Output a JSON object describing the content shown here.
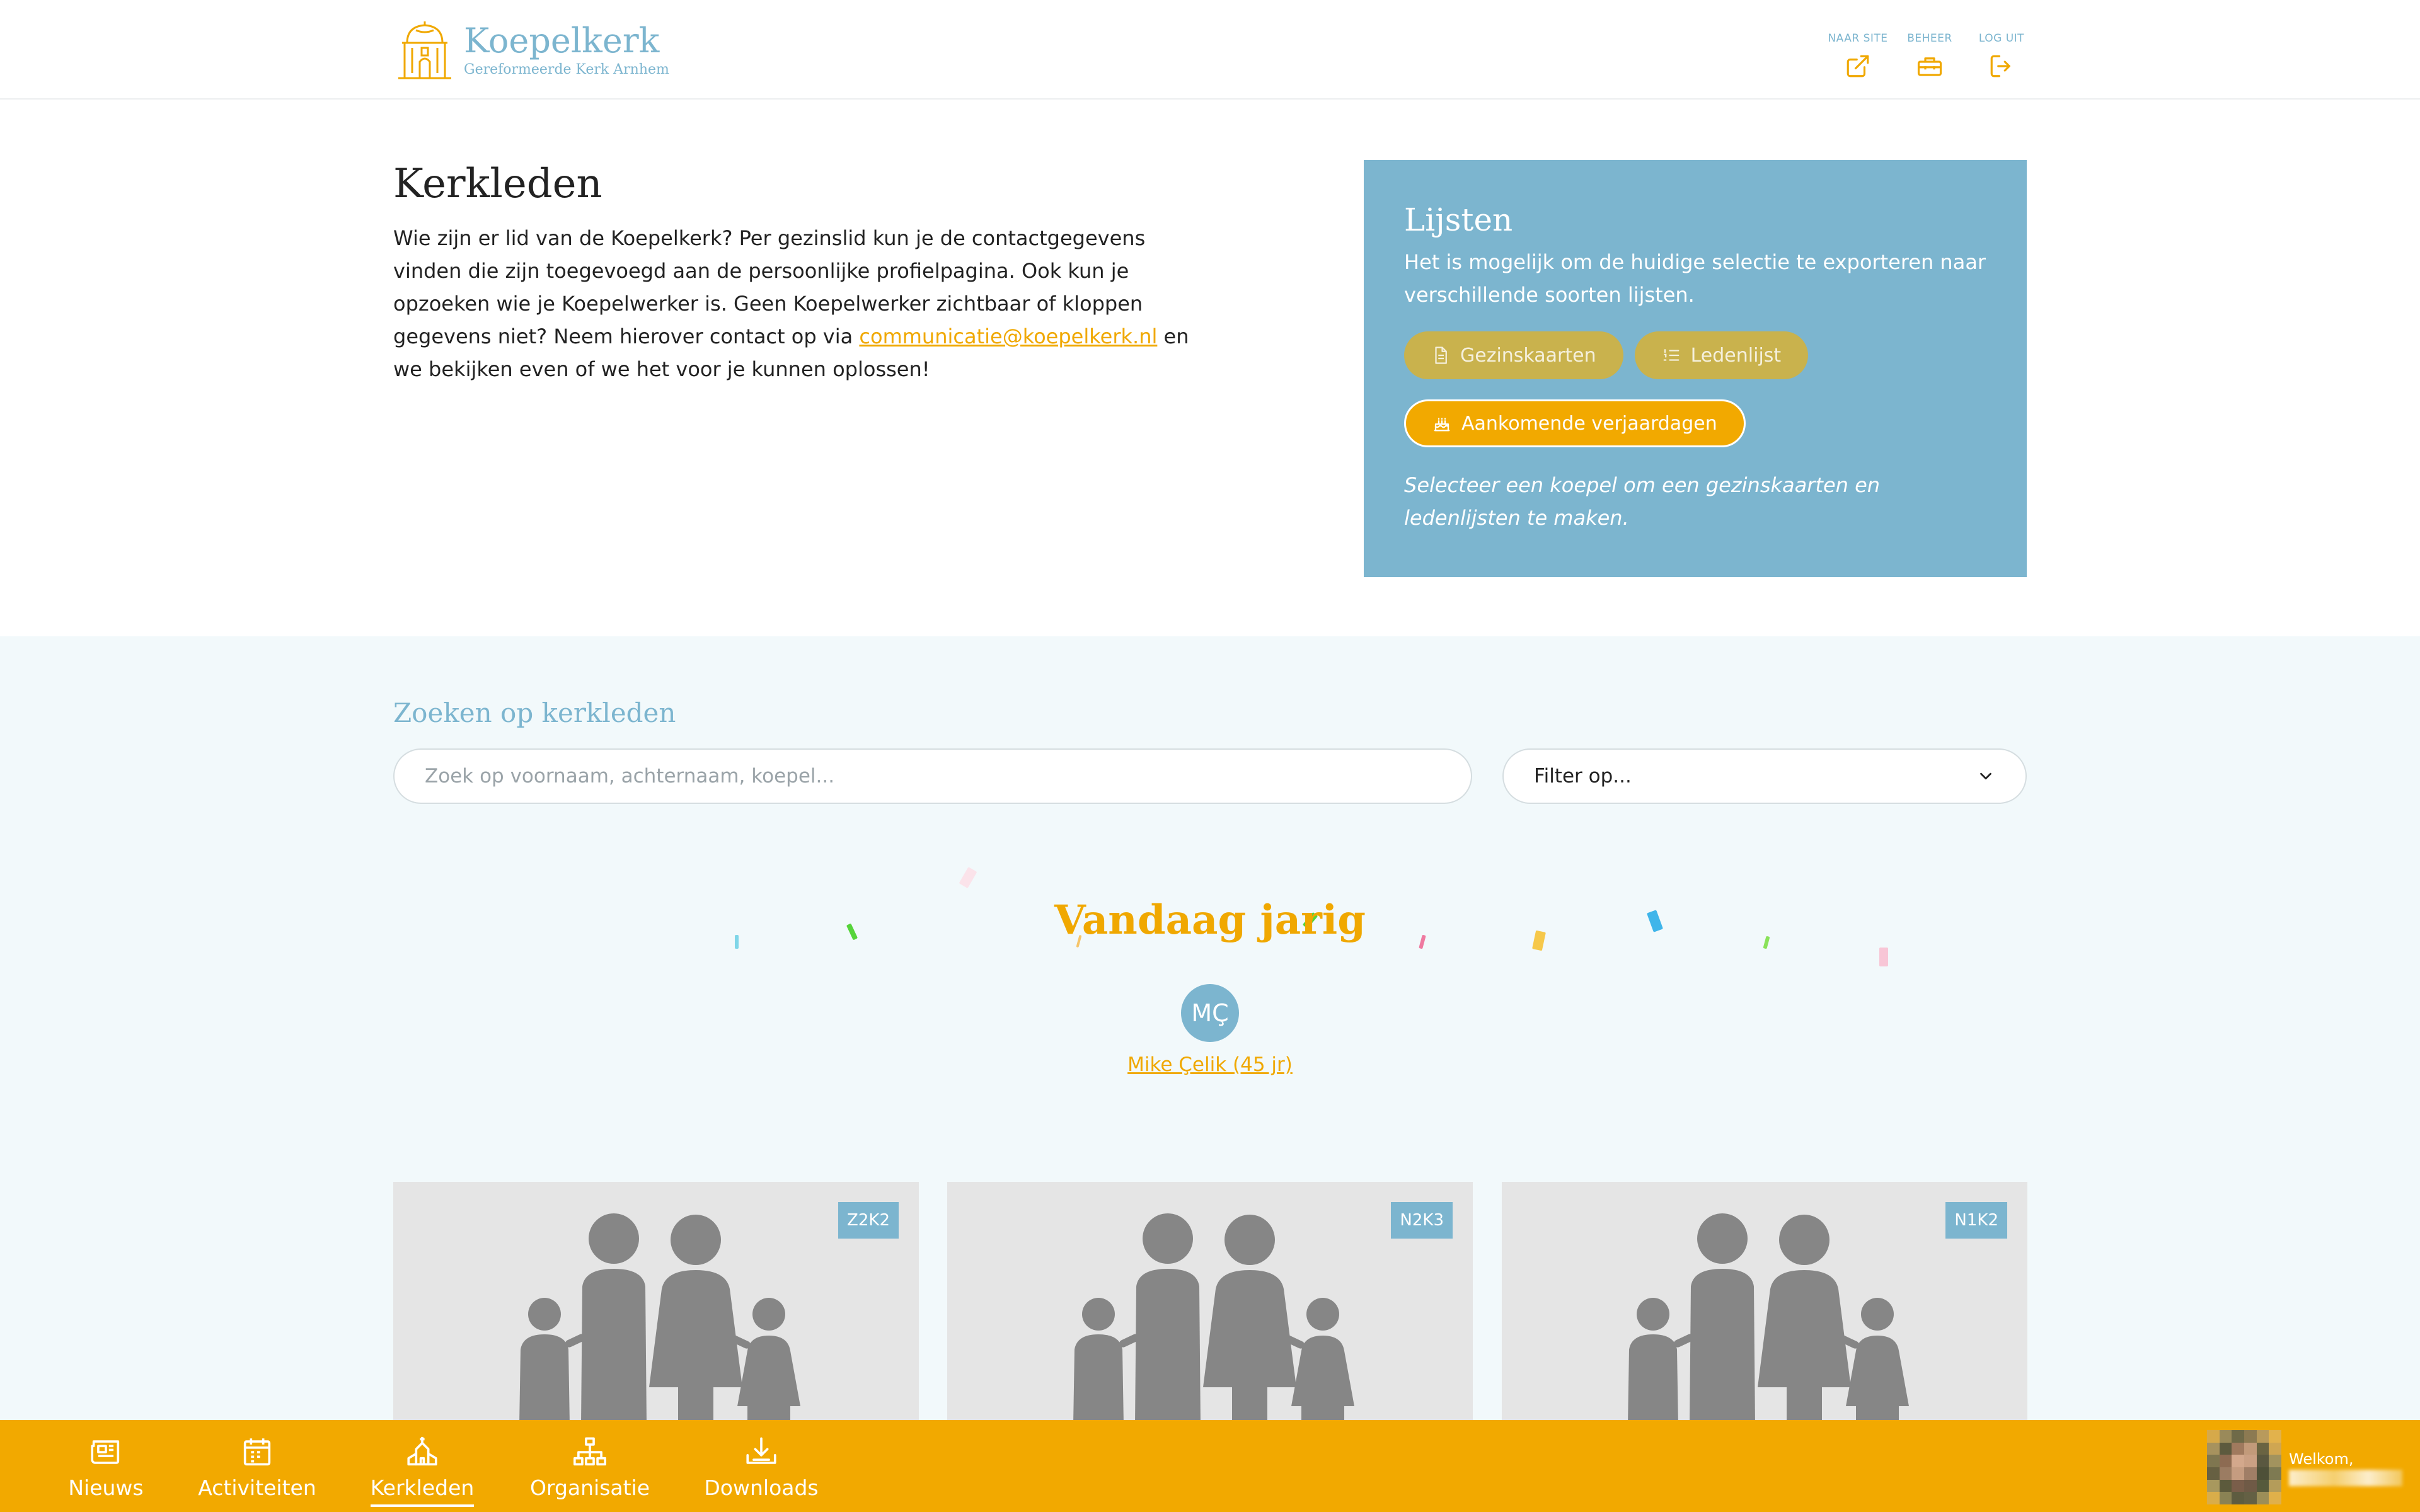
{
  "header": {
    "logo_title": "Koepelkerk",
    "logo_subtitle": "Gereformeerde Kerk Arnhem",
    "actions": [
      {
        "label": "NAAR SITE",
        "icon": "external-link-icon"
      },
      {
        "label": "BEHEER",
        "icon": "toolbox-icon"
      },
      {
        "label": "LOG UIT",
        "icon": "logout-icon"
      }
    ]
  },
  "intro": {
    "title": "Kerkleden",
    "text_before": "Wie zijn er lid van de Koepelkerk? Per gezinslid kun je de contactgegevens vinden die zijn toegevoegd aan de persoonlijke profielpagina. Ook kun je opzoeken wie je Koepelwerker is. Geen Koepelwerker zichtbaar of kloppen gegevens niet? Neem hierover contact op via ",
    "link": "communicatie@koepelkerk.nl",
    "text_after": " en we bekijken even of we het voor je kunnen oplossen!"
  },
  "lists": {
    "title": "Lijsten",
    "text": "Het is mogelijk om de huidige selectie te exporteren naar verschillende soorten lijsten.",
    "gezinskaarten_label": "Gezinskaarten",
    "ledenlijst_label": "Ledenlijst",
    "verjaardagen_label": "Aankomende verjaardagen",
    "note": "Selecteer een koepel om een gezinskaarten en ledenlijsten te maken."
  },
  "search": {
    "title": "Zoeken op kerkleden",
    "placeholder": "Zoek op voornaam, achternaam, koepel...",
    "filter_value": "Filter op..."
  },
  "birthday": {
    "title": "Vandaag jarig",
    "initials": "MÇ",
    "name": "Mike Çelik (45 jr)"
  },
  "cards": [
    {
      "badge": "Z2K2"
    },
    {
      "badge": "N2K3"
    },
    {
      "badge": "N1K2"
    }
  ],
  "nav": {
    "items": [
      {
        "label": "Nieuws",
        "icon": "newspaper-icon"
      },
      {
        "label": "Activiteiten",
        "icon": "calendar-icon"
      },
      {
        "label": "Kerkleden",
        "icon": "church-icon"
      },
      {
        "label": "Organisatie",
        "icon": "org-chart-icon"
      },
      {
        "label": "Downloads",
        "icon": "download-icon"
      }
    ],
    "active": "Kerkleden",
    "welcome": "Welkom,"
  },
  "colors": {
    "brand_blue": "#7cb5cf",
    "brand_yellow": "#f2a900",
    "muted_gold": "#c9b24d",
    "section_bg": "#f2f9fb"
  }
}
